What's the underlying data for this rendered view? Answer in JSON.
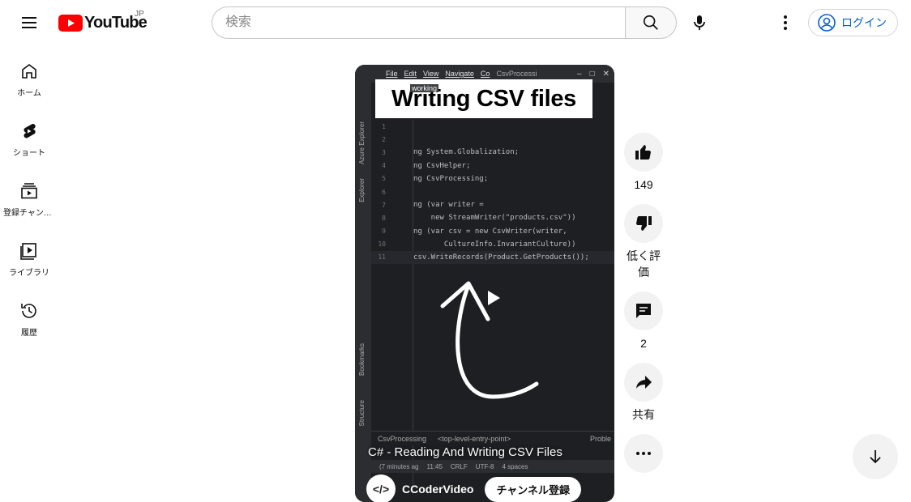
{
  "header": {
    "logo_text": "YouTube",
    "country_code": "JP",
    "search_placeholder": "検索",
    "login_label": "ログイン"
  },
  "sidebar": {
    "items": [
      {
        "label": "ホーム",
        "icon": "home-icon"
      },
      {
        "label": "ショート",
        "icon": "shorts-icon"
      },
      {
        "label": "登録チャンネル",
        "icon": "subscriptions-icon"
      },
      {
        "label": "ライブラリ",
        "icon": "library-icon"
      },
      {
        "label": "履歴",
        "icon": "history-icon"
      }
    ]
  },
  "video": {
    "thumbnail_title": "Writing CSV files",
    "working_tag": "working",
    "ide_menu": [
      "File",
      "Edit",
      "View",
      "Navigate",
      "Co"
    ],
    "ide_project": "CsvProcessi",
    "ide_left_labels": [
      "Azure Explorer",
      "Explorer",
      "Bookmarks",
      "Structure"
    ],
    "code_lines": [
      {
        "n": "1",
        "text": ""
      },
      {
        "n": "2",
        "text": ""
      },
      {
        "n": "3",
        "text": "ng System.Globalization;"
      },
      {
        "n": "4",
        "text": "ng CsvHelper;"
      },
      {
        "n": "5",
        "text": "ng CsvProcessing;"
      },
      {
        "n": "6",
        "text": ""
      },
      {
        "n": "7",
        "text": "ng (var writer ="
      },
      {
        "n": "8",
        "text": "    new StreamWriter(\"products.csv\"))"
      },
      {
        "n": "9",
        "text": "ng (var csv = new CsvWriter(writer,"
      },
      {
        "n": "10",
        "text": "       CultureInfo.InvariantCulture))"
      },
      {
        "n": "11",
        "text": "csv.WriteRecords(Product.GetProducts());"
      }
    ],
    "breadcrumb": [
      "CsvProcessing",
      "<top-level-entry-point>"
    ],
    "problems_label": "Proble",
    "status_items": [
      "(7 minutes ag",
      "11:45",
      "CRLF",
      "UTF-8",
      "4 spaces"
    ],
    "title": "C# - Reading And Writing CSV Files",
    "channel_name": "CCoderVideo",
    "subscribe_label": "チャンネル登録"
  },
  "actions": {
    "like_count": "149",
    "dislike_label": "低く評価",
    "comment_count": "2",
    "share_label": "共有"
  },
  "colors": {
    "brand_red": "#ff0000",
    "link_blue": "#065fd4"
  }
}
